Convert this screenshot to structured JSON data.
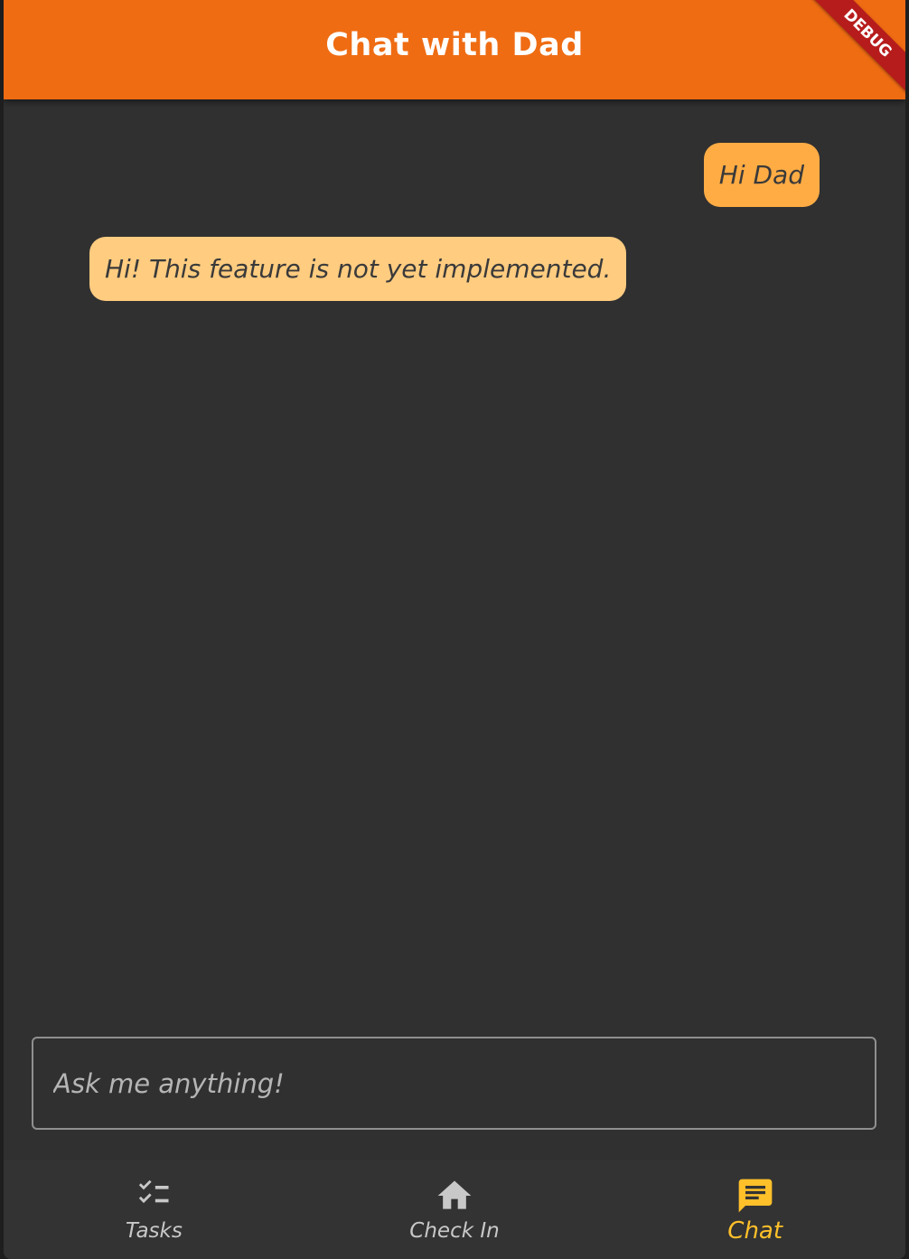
{
  "app_bar": {
    "title": "Chat with Dad",
    "background": "#ef6c13"
  },
  "debug_banner": {
    "label": "DEBUG"
  },
  "messages": [
    {
      "sender": "user",
      "text": "Hi Dad",
      "color": "#ffac44"
    },
    {
      "sender": "dad",
      "text": "Hi! This feature is not yet implemented.",
      "color": "#ffcc80"
    }
  ],
  "input": {
    "placeholder": "Ask me anything!",
    "value": ""
  },
  "bottom_nav": {
    "items": [
      {
        "label": "Tasks",
        "icon": "checklist-icon",
        "active": false
      },
      {
        "label": "Check In",
        "icon": "home-icon",
        "active": false
      },
      {
        "label": "Chat",
        "icon": "chat-icon",
        "active": true
      }
    ],
    "active_color": "#ffc02a",
    "inactive_color": "#c8c8c8"
  }
}
